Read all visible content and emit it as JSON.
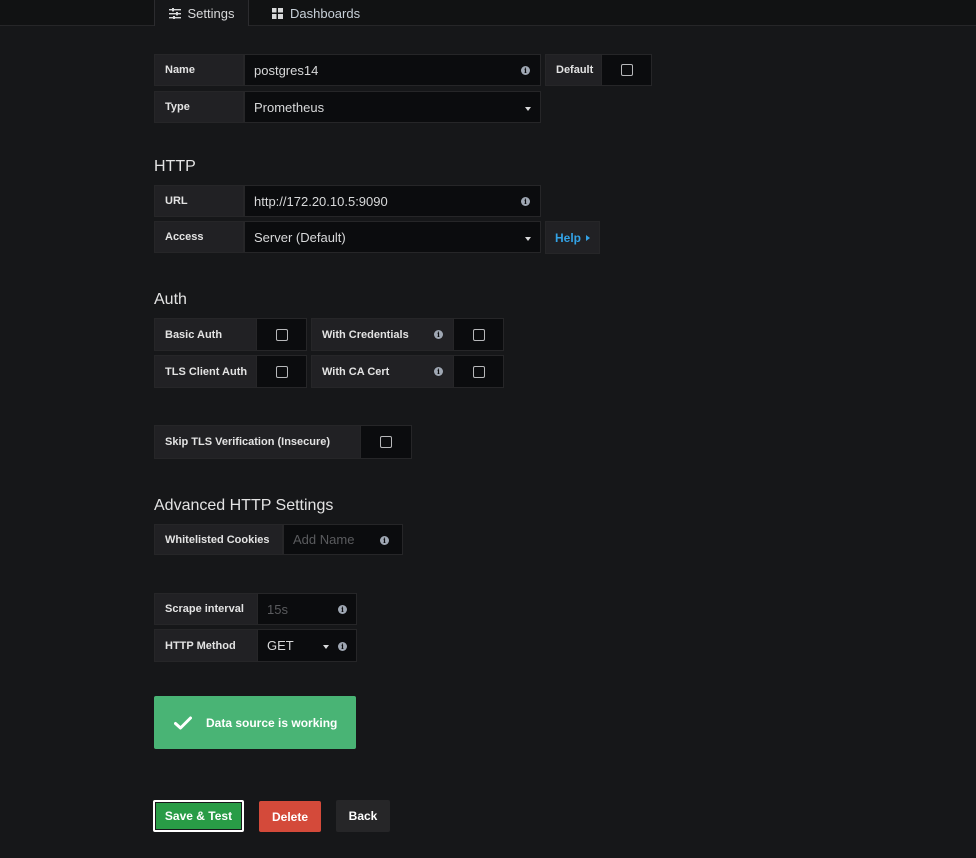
{
  "tabs": {
    "settings": {
      "label": "Settings",
      "icon": "sliders-icon"
    },
    "dashboards": {
      "label": "Dashboards",
      "icon": "grid-icon"
    }
  },
  "basic": {
    "name_label": "Name",
    "name_value": "postgres14",
    "default_label": "Default",
    "default_checked": false,
    "type_label": "Type",
    "type_value": "Prometheus"
  },
  "http": {
    "heading": "HTTP",
    "url_label": "URL",
    "url_value": "http://172.20.10.5:9090",
    "access_label": "Access",
    "access_value": "Server (Default)",
    "help_label": "Help"
  },
  "auth": {
    "heading": "Auth",
    "basic_auth_label": "Basic Auth",
    "with_credentials_label": "With Credentials",
    "tls_client_auth_label": "TLS Client Auth",
    "with_ca_cert_label": "With CA Cert",
    "skip_tls_label": "Skip TLS Verification (Insecure)"
  },
  "advanced": {
    "heading": "Advanced HTTP Settings",
    "cookies_label": "Whitelisted Cookies",
    "cookies_placeholder": "Add Name"
  },
  "prometheus": {
    "scrape_label": "Scrape interval",
    "scrape_placeholder": "15s",
    "method_label": "HTTP Method",
    "method_value": "GET"
  },
  "status": {
    "message": "Data source is working",
    "color": "#49b475"
  },
  "actions": {
    "save_label": "Save & Test",
    "delete_label": "Delete",
    "back_label": "Back"
  }
}
